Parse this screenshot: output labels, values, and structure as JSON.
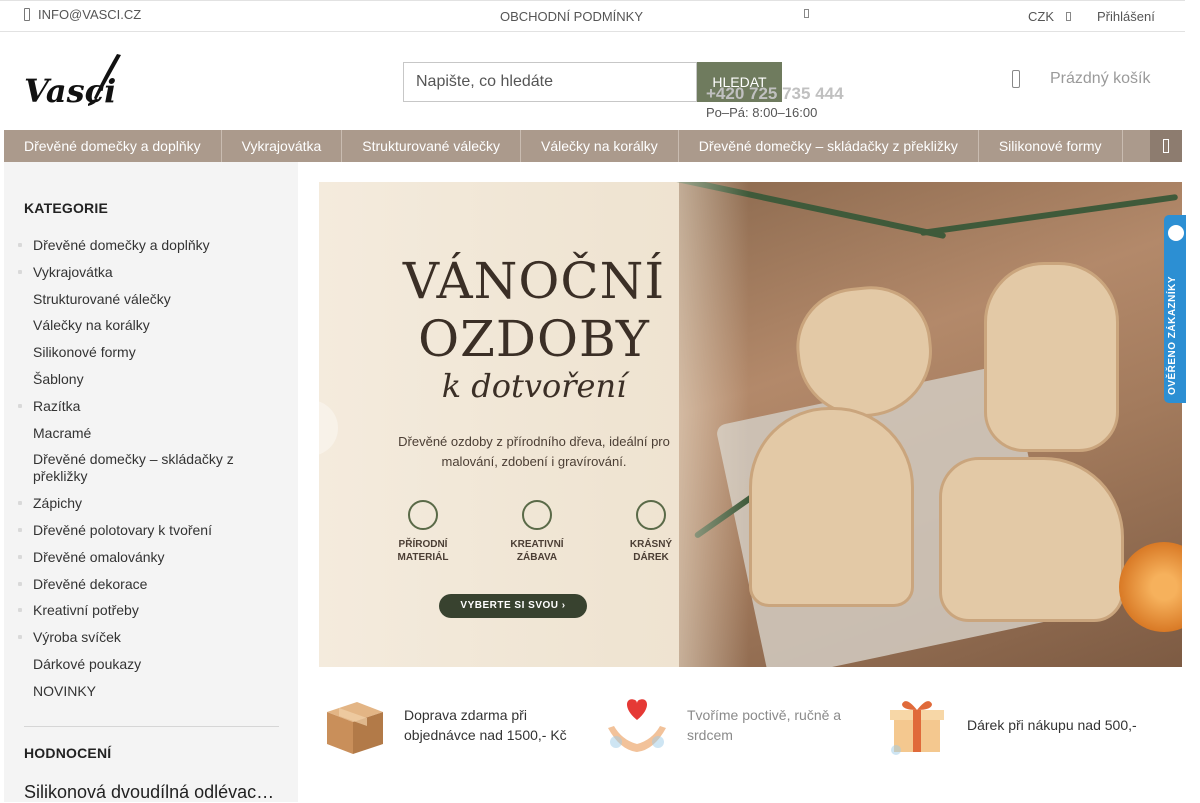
{
  "topbar": {
    "email": "INFO@VASCI.CZ",
    "terms": "OBCHODNÍ PODMÍNKY",
    "currency": "CZK",
    "login": "Přihlášení"
  },
  "header": {
    "logo_text": "Vasci",
    "search_placeholder": "Napište, co hledáte",
    "search_button": "HLEDAT",
    "phone": "+420 725 735 444",
    "hours": "Po–Pá: 8:00–16:00",
    "cart": "Prázdný košík"
  },
  "nav": {
    "items": [
      "Dřevěné domečky a doplňky",
      "Vykrajovátka",
      "Strukturované válečky",
      "Válečky na korálky",
      "Dřevěné domečky – skládačky z překližky",
      "Silikonové formy"
    ]
  },
  "sidebar": {
    "categories_title": "KATEGORIE",
    "categories": [
      "Dřevěné domečky a doplňky",
      "Vykrajovátka",
      "Strukturované válečky",
      "Válečky na korálky",
      "Silikonové formy",
      "Šablony",
      "Razítka",
      "Macramé",
      "Dřevěné domečky – skládačky z překližky",
      "Zápichy",
      "Dřevěné polotovary k tvoření",
      "Dřevěné omalovánky",
      "Dřevěné dekorace",
      "Kreativní potřeby",
      "Výroba svíček",
      "Dárkové poukazy",
      "NOVINKY"
    ],
    "reviews_title": "HODNOCENÍ",
    "review_item": "Silikonová dvoudílná odlévací forma"
  },
  "banner": {
    "title_line1": "VÁNOČNÍ",
    "title_line2": "OZDOBY",
    "subtitle": "k dotvoření",
    "description": "Dřevěné ozdoby z přírodního dřeva, ideální pro malování, zdobení i gravírování.",
    "features": [
      {
        "line1": "PŘÍRODNÍ",
        "line2": "MATERIÁL"
      },
      {
        "line1": "KREATIVNÍ",
        "line2": "ZÁBAVA"
      },
      {
        "line1": "KRÁSNÝ",
        "line2": "DÁREK"
      }
    ],
    "cta": "VYBERTE SI SVOU ›"
  },
  "benefits": [
    "Doprava zdarma při objednávce nad 1500,- Kč",
    "Tvoříme poctivě, ručně a srdcem",
    "Dárek při nákupu nad 500,-"
  ],
  "verified_badge": "OVĚŘENO ZÁKAZNÍKY",
  "colors": {
    "nav_bg": "#ab9a8c",
    "search_button": "#6f7b5e",
    "sidebar_bg": "#f4f4f4",
    "verified": "#2c8fd3"
  }
}
